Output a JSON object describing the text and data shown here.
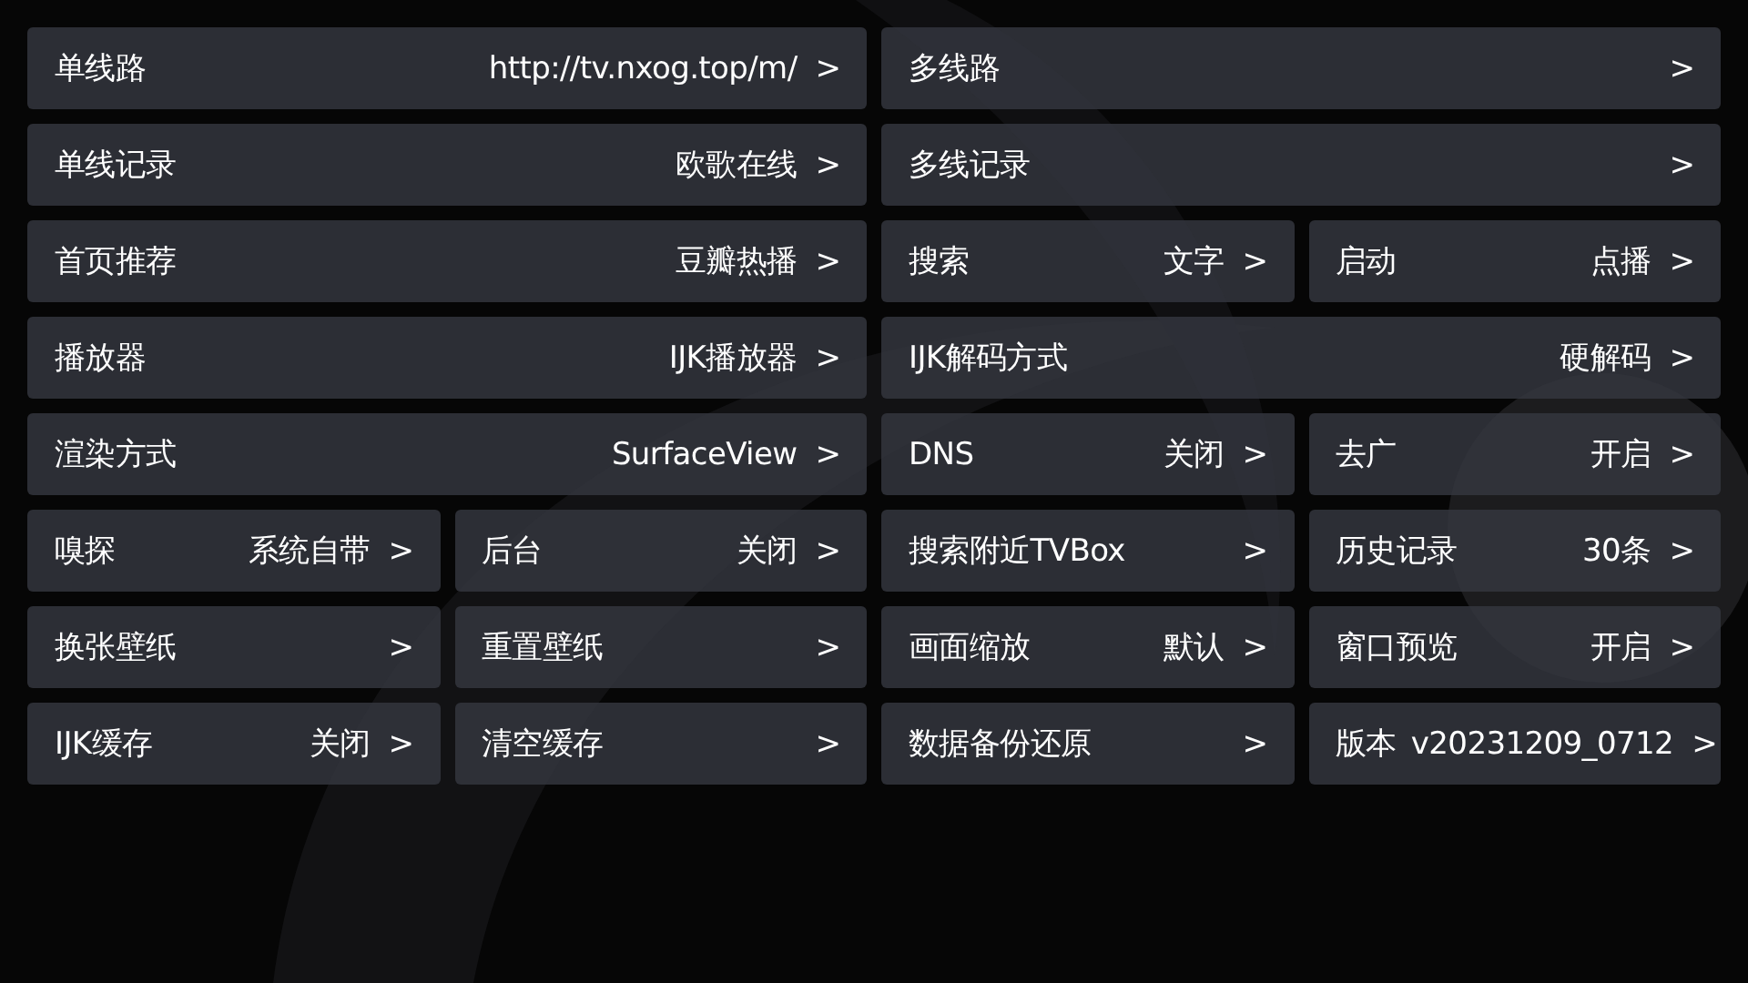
{
  "rows": [
    [
      {
        "kind": "wide",
        "label": "单线路",
        "value": "http://tv.nxog.top/m/",
        "arrow": ">"
      },
      {
        "kind": "wide",
        "label": "多线路",
        "arrow": ">"
      }
    ],
    [
      {
        "kind": "wide",
        "label": "单线记录",
        "value": "欧歌在线",
        "arrow": ">"
      },
      {
        "kind": "wide",
        "label": "多线记录",
        "arrow": ">"
      }
    ],
    [
      {
        "kind": "wide",
        "label": "首页推荐",
        "value": "豆瓣热播",
        "arrow": ">"
      },
      {
        "kind": "narrow",
        "label": "搜索",
        "value": "文字",
        "arrow": ">"
      },
      {
        "kind": "narrow",
        "label": "启动",
        "value": "点播",
        "arrow": ">"
      }
    ],
    [
      {
        "kind": "wide",
        "label": "播放器",
        "value": "IJK播放器",
        "arrow": ">"
      },
      {
        "kind": "wide",
        "label": "IJK解码方式",
        "value": "硬解码",
        "arrow": ">"
      }
    ],
    [
      {
        "kind": "wide",
        "label": "渲染方式",
        "value": "SurfaceView",
        "arrow": ">"
      },
      {
        "kind": "narrow",
        "label": "DNS",
        "value": "关闭",
        "arrow": ">"
      },
      {
        "kind": "narrow",
        "label": "去广",
        "value": "开启",
        "arrow": ">"
      }
    ],
    [
      {
        "kind": "narrow",
        "label": "嗅探",
        "value": "系统自带",
        "arrow": ">"
      },
      {
        "kind": "narrow",
        "label": "后台",
        "value": "关闭",
        "arrow": ">"
      },
      {
        "kind": "narrow",
        "label": "搜索附近TVBox",
        "arrow": ">"
      },
      {
        "kind": "narrow",
        "label": "历史记录",
        "value": "30条",
        "arrow": ">"
      }
    ],
    [
      {
        "kind": "narrow",
        "label": "换张壁纸",
        "arrow": ">"
      },
      {
        "kind": "narrow",
        "label": "重置壁纸",
        "arrow": ">"
      },
      {
        "kind": "narrow",
        "label": "画面缩放",
        "value": "默认",
        "arrow": ">"
      },
      {
        "kind": "narrow",
        "label": "窗口预览",
        "value": "开启",
        "arrow": ">"
      }
    ],
    [
      {
        "kind": "narrow",
        "label": "IJK缓存",
        "value": "关闭",
        "arrow": ">"
      },
      {
        "kind": "narrow",
        "label": "清空缓存",
        "arrow": ">"
      },
      {
        "kind": "narrow",
        "label": "数据备份还原",
        "arrow": ">"
      },
      {
        "kind": "narrow",
        "label": "版本",
        "value": "v20231209_0712",
        "arrow": ">"
      }
    ]
  ]
}
